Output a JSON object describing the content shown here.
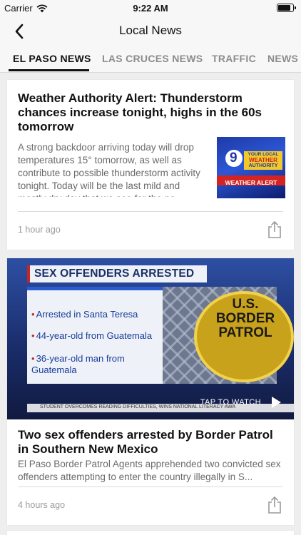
{
  "status_bar": {
    "carrier": "Carrier",
    "time": "9:22 AM",
    "battery_level": 0.9
  },
  "nav": {
    "title": "Local News"
  },
  "tabs": [
    {
      "label": "EL PASO NEWS",
      "active": true
    },
    {
      "label": "LAS CRUCES NEWS",
      "active": false
    },
    {
      "label": "TRAFFIC",
      "active": false
    },
    {
      "label": "NEWS",
      "active": false
    }
  ],
  "articles": [
    {
      "headline": "Weather Authority Alert: Thunderstorm chances increase tonight, highs in the 60s tomorrow",
      "summary": "A strong backdoor arriving today will drop temperatures 15° tomorrow, as well as contribute to possible thunderstorm activity tonight. Today will be the last mild and mostly dry day that we see for the ne...",
      "timestamp": "1 hour ago",
      "thumbnail": {
        "number": "9",
        "line1": "YOUR LOCAL",
        "line2": "WEATHER",
        "line3": "AUTHORITY",
        "alert": "WEATHER ALERT"
      }
    },
    {
      "headline": "Two sex offenders arrested by Border Patrol in Southern New Mexico",
      "summary": "El Paso Border Patrol Agents apprehended two convicted sex offenders attempting to enter the country illegally in S...",
      "timestamp": "4 hours ago",
      "video": {
        "banner": "SEX OFFENDERS ARRESTED",
        "bullets": [
          "Arrested in Santa Teresa",
          "44-year-old from Guatemala",
          "36-year-old man from Guatemala"
        ],
        "patrol_text": "U.S. BORDER PATROL",
        "ticker": "STUDENT OVERCOMES READING DIFFICULTIES, WINS NATIONAL LITERACY AWA",
        "cta": "TAP TO WATCH"
      }
    }
  ],
  "colors": {
    "alert_red": "#c62525",
    "accent_blue": "#2a5bd0",
    "tab_inactive": "#8c8c8c"
  },
  "icons": [
    "wifi-icon",
    "battery-icon",
    "back-chevron-icon",
    "share-icon",
    "play-icon"
  ]
}
